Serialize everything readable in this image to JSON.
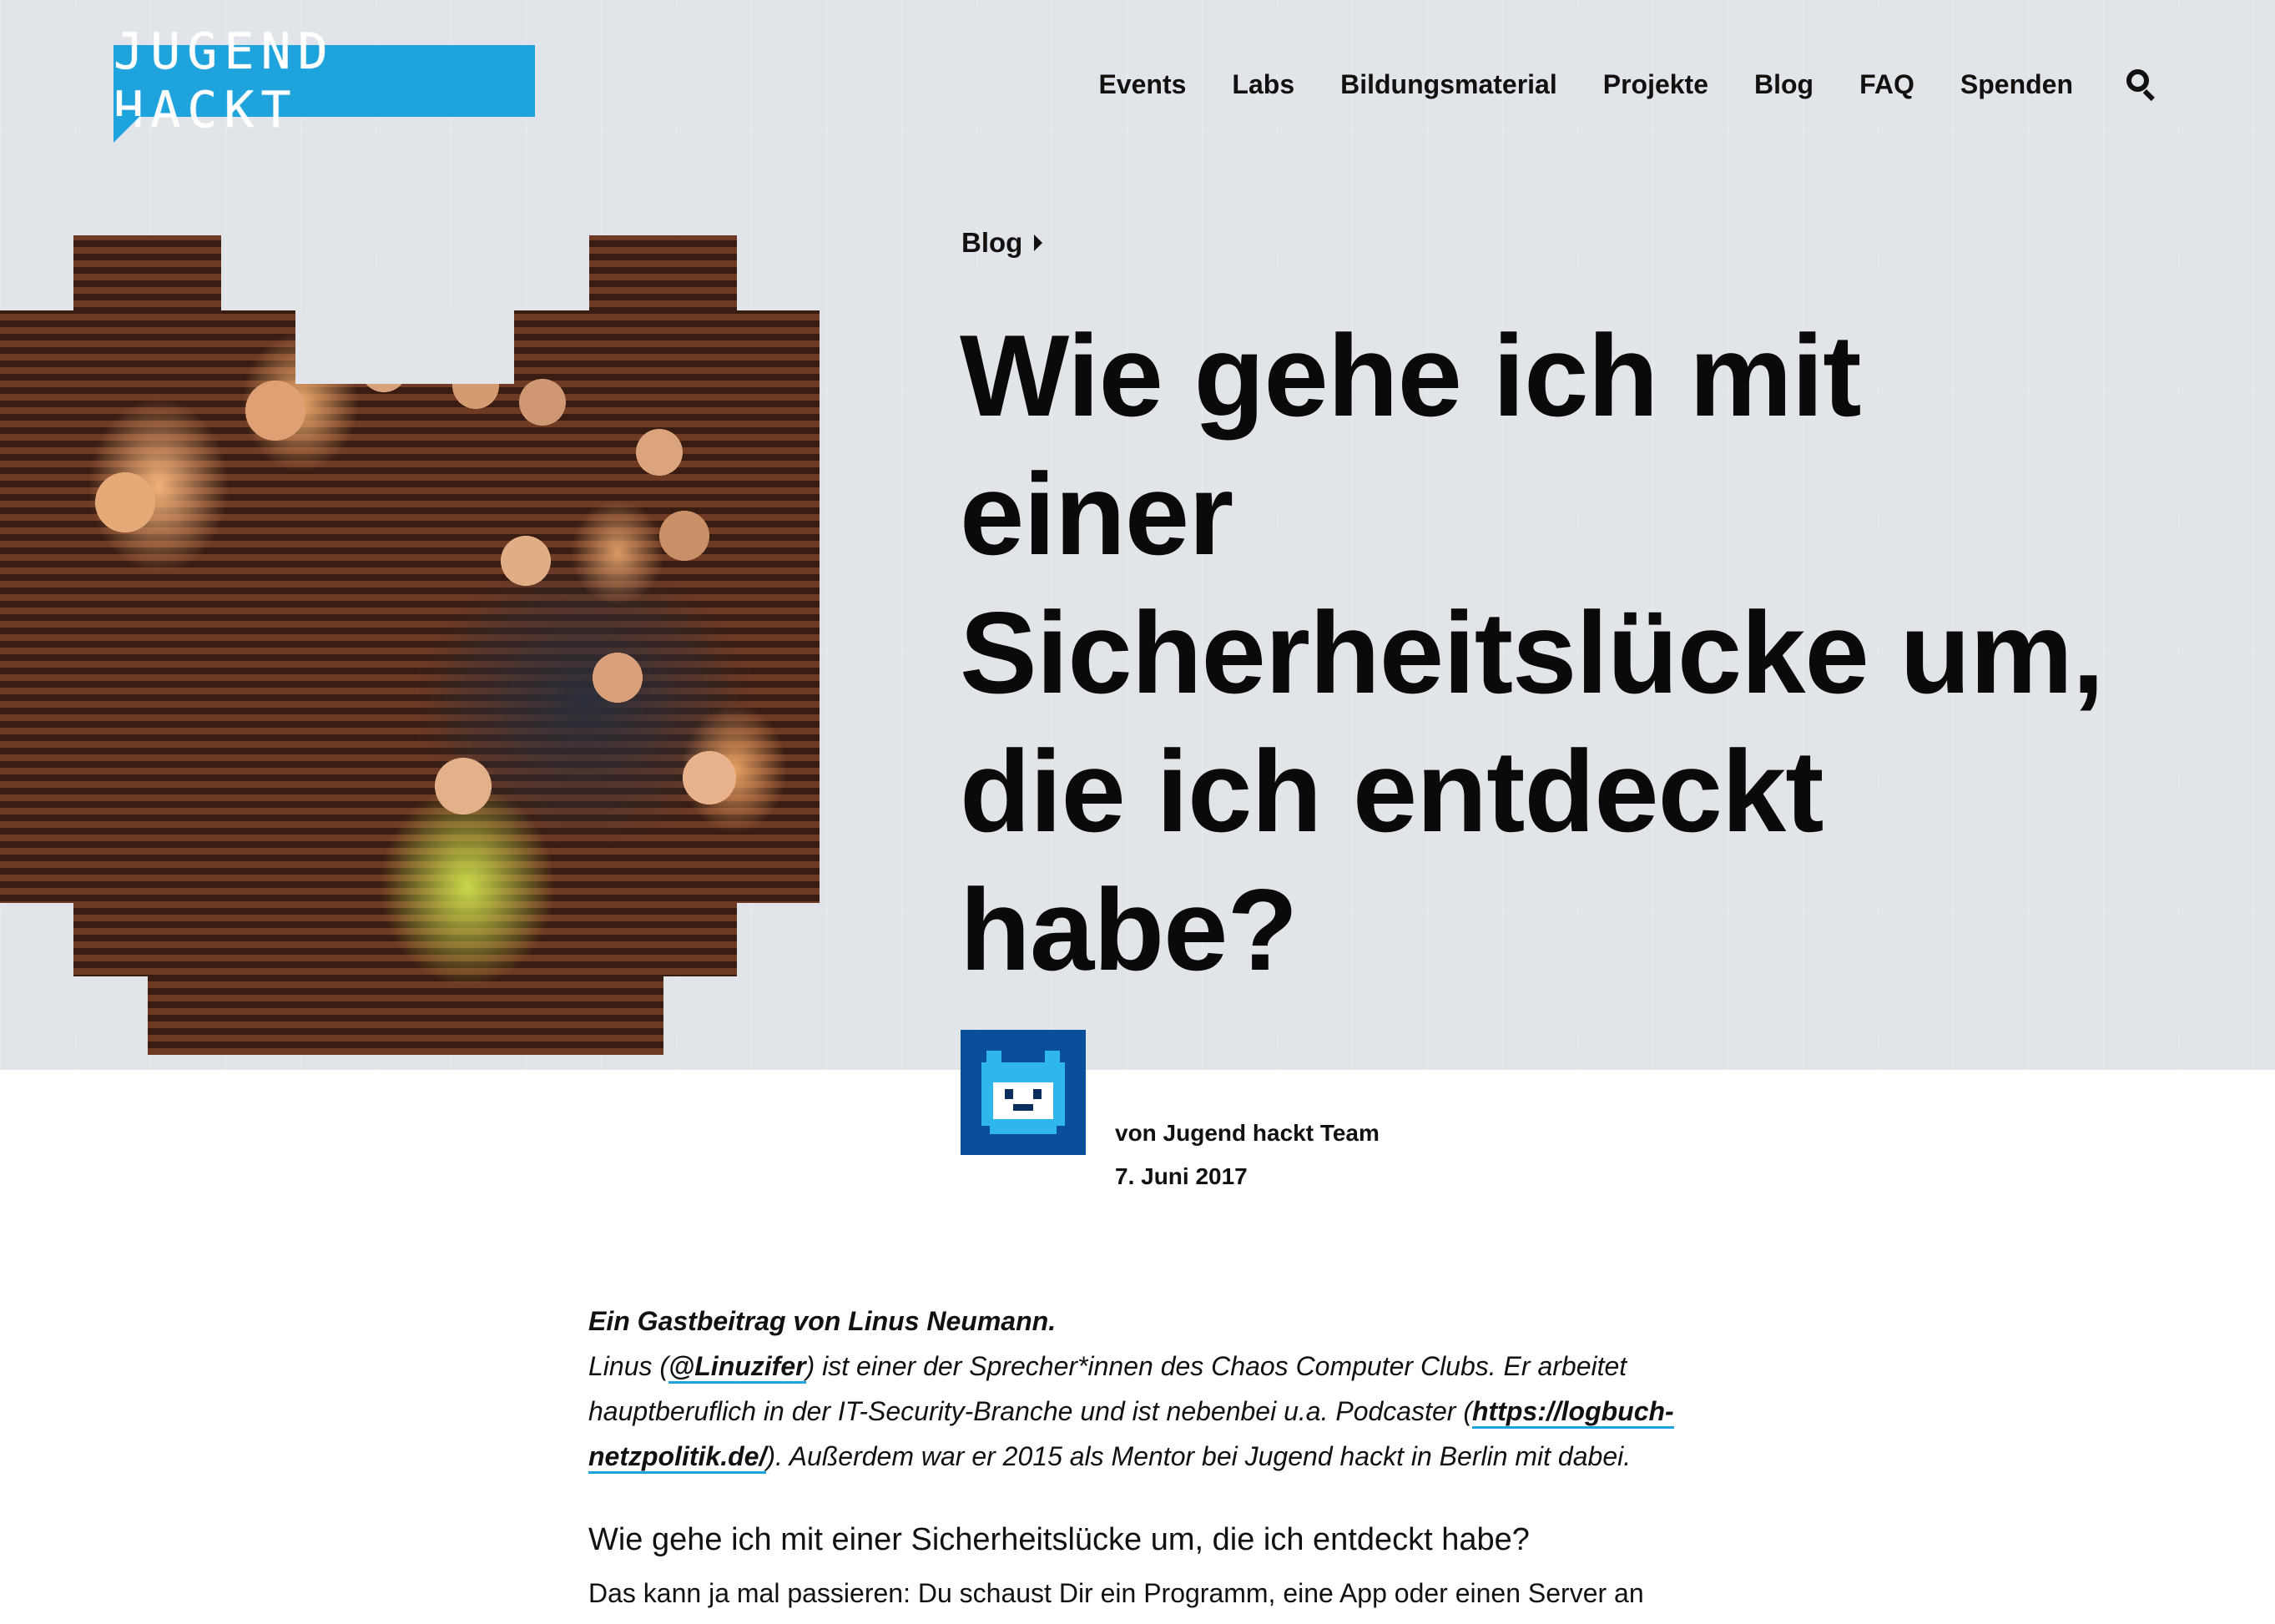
{
  "logo": {
    "text": "JUGEND HACKT"
  },
  "nav": {
    "items": [
      "Events",
      "Labs",
      "Bildungsmaterial",
      "Projekte",
      "Blog",
      "FAQ",
      "Spenden"
    ],
    "search_icon": "search-icon"
  },
  "breadcrumb": {
    "label": "Blog"
  },
  "post": {
    "title": "Wie gehe ich mit einer Sicherheitslücke um, die ich entdeckt habe?",
    "author_line": "von Jugend hackt Team",
    "date": "7. Juni 2017"
  },
  "article": {
    "guest_line": "Ein Gastbeitrag von Linus Neumann.",
    "bio_part1": "Linus (",
    "bio_handle": "@Linuzifer",
    "bio_part2": ") ist einer der Sprecher*innen des Chaos Computer Clubs. Er arbeitet hauptberuflich in der IT-Security-Branche und ist nebenbei u.a. Podcaster (",
    "bio_link": "https://logbuch-netzpolitik.de/",
    "bio_part3": "). Außerdem war er 2015 als Mentor bei Jugend hackt in Berlin mit dabei.",
    "heading": "Wie gehe ich mit einer Sicherheitslücke um, die ich entdeckt habe?",
    "first_para": "Das kann ja mal passieren: Du schaust Dir ein Programm, eine App oder einen Server an und"
  },
  "colors": {
    "brand_blue": "#1fa3dc",
    "hero_bg": "#e1e5ea",
    "avatar_bg": "#0a4f9c"
  }
}
